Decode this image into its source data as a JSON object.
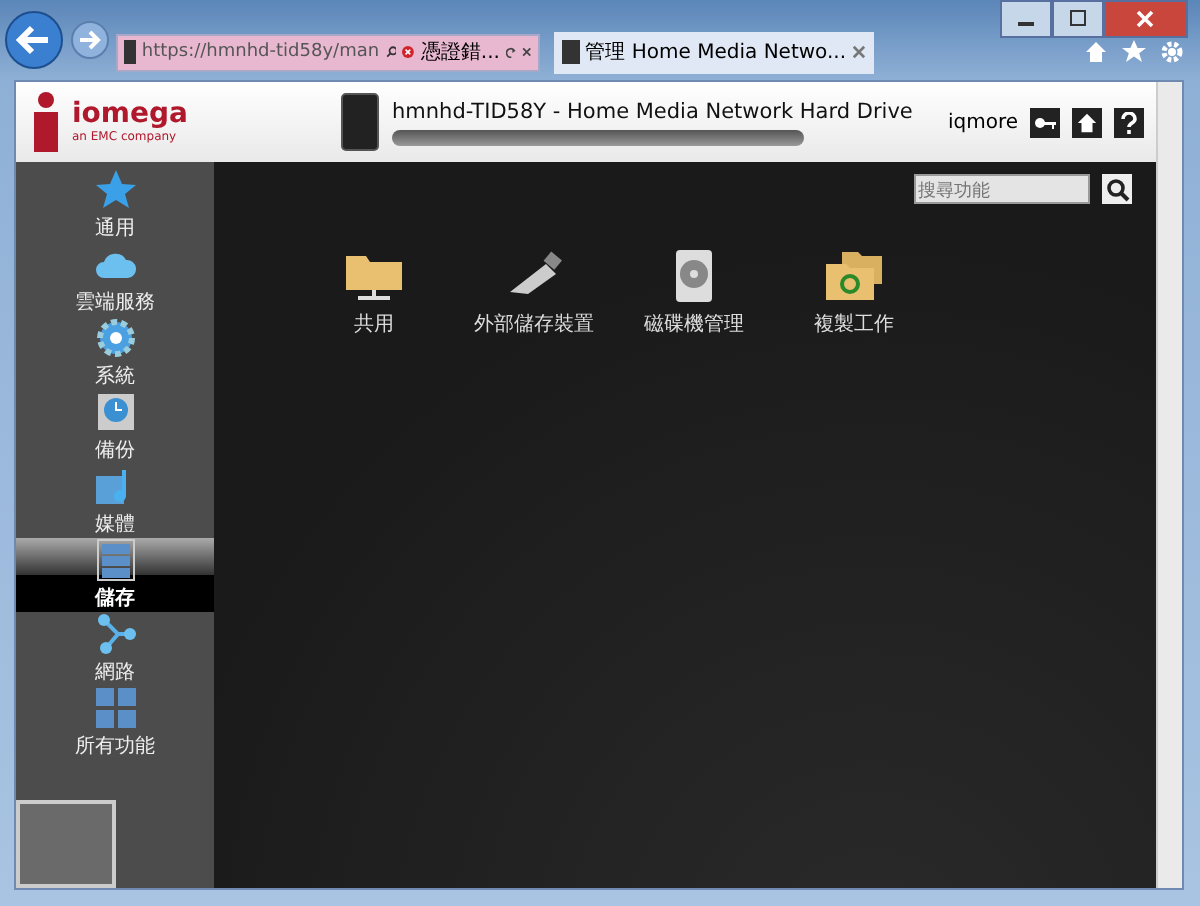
{
  "browser": {
    "address": "https://hmnhd-tid58y/man",
    "cert_error": "憑證錯...",
    "tab_title": "管理 Home Media Netwo..."
  },
  "header": {
    "logo": "iomega",
    "logo_sub": "an EMC company",
    "device_title": "hmnhd-TID58Y - Home Media Network Hard Drive",
    "user": "iqmore"
  },
  "sidebar": {
    "items": [
      {
        "label": "通用",
        "selected": false
      },
      {
        "label": "雲端服務",
        "selected": false
      },
      {
        "label": "系統",
        "selected": false
      },
      {
        "label": "備份",
        "selected": false
      },
      {
        "label": "媒體",
        "selected": false
      },
      {
        "label": "儲存",
        "selected": true
      },
      {
        "label": "網路",
        "selected": false
      },
      {
        "label": "所有功能",
        "selected": false
      }
    ]
  },
  "search": {
    "placeholder": "搜尋功能"
  },
  "features": [
    {
      "label": "共用"
    },
    {
      "label": "外部儲存裝置"
    },
    {
      "label": "磁碟機管理"
    },
    {
      "label": "複製工作"
    }
  ]
}
